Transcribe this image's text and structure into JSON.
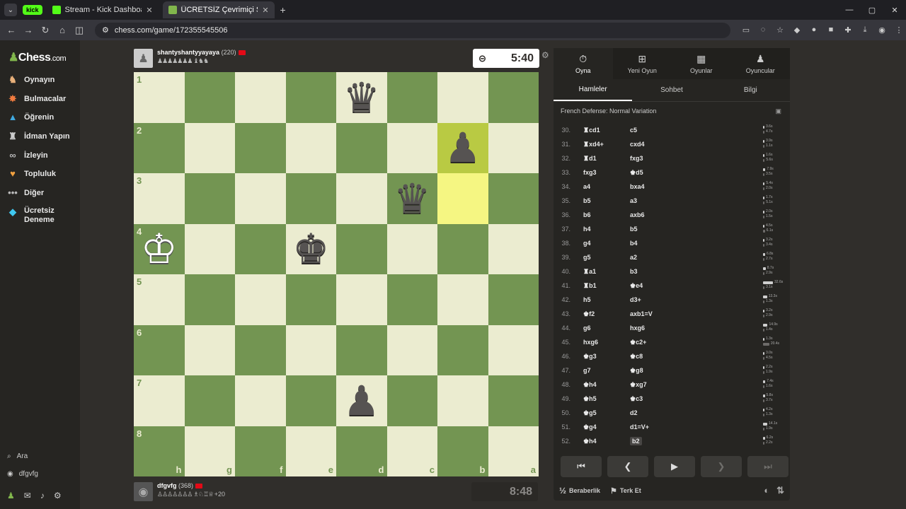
{
  "browser": {
    "tabs": [
      {
        "label": "Stream - Kick Dashboard",
        "favicon_color": "#53fc18"
      },
      {
        "label": "ÜCRETSİZ Çevrimiçi Satranç Oy...",
        "favicon_color": "#81b64c"
      }
    ],
    "tab_group": "kick",
    "url": "chess.com/game/172355545506"
  },
  "sidebar": {
    "logo_text": "Chess",
    "logo_suffix": ".com",
    "items": [
      {
        "label": "Oynayın",
        "icon": "play-board-icon"
      },
      {
        "label": "Bulmacalar",
        "icon": "puzzle-icon"
      },
      {
        "label": "Öğrenin",
        "icon": "learn-cap-icon"
      },
      {
        "label": "İdman Yapın",
        "icon": "train-icon"
      },
      {
        "label": "İzleyin",
        "icon": "binoculars-icon"
      },
      {
        "label": "Topluluk",
        "icon": "community-icon"
      },
      {
        "label": "Diğer",
        "icon": "more-dots-icon"
      },
      {
        "label": "Ücretsiz Deneme",
        "icon": "diamond-icon"
      }
    ],
    "search_label": "Ara",
    "user_label": "dfgvfg"
  },
  "top_player": {
    "name": "shantyshantyyayaya",
    "rating": "(220)",
    "captured": "♟♟♟♟♟♟♟ ♝♞♞"
  },
  "bottom_player": {
    "name": "dfgvfg",
    "rating": "(368)",
    "captured": "♙♙♙♙♙♙♙ ♗♘♖♕",
    "material": "+20"
  },
  "clocks": {
    "top": "5:40",
    "bottom": "8:48"
  },
  "board": {
    "ranks": [
      "1",
      "2",
      "3",
      "4",
      "5",
      "6",
      "7",
      "8"
    ],
    "files": [
      "h",
      "g",
      "f",
      "e",
      "d",
      "c",
      "b",
      "a"
    ],
    "pieces": [
      {
        "row": 0,
        "col": 4,
        "glyph": "♛",
        "color": "b"
      },
      {
        "row": 1,
        "col": 6,
        "glyph": "♟",
        "color": "b"
      },
      {
        "row": 2,
        "col": 5,
        "glyph": "♛",
        "color": "b"
      },
      {
        "row": 3,
        "col": 0,
        "glyph": "♔",
        "color": "w"
      },
      {
        "row": 3,
        "col": 3,
        "glyph": "♚",
        "color": "b"
      },
      {
        "row": 6,
        "col": 4,
        "glyph": "♟",
        "color": "b"
      }
    ],
    "highlights": [
      {
        "row": 1,
        "col": 6
      },
      {
        "row": 2,
        "col": 6
      }
    ]
  },
  "panel": {
    "tabs": [
      {
        "label": "Oyna",
        "icon": "stopwatch-icon"
      },
      {
        "label": "Yeni Oyun",
        "icon": "plus-square-icon"
      },
      {
        "label": "Oyunlar",
        "icon": "board-grid-icon"
      },
      {
        "label": "Oyuncular",
        "icon": "players-icon"
      }
    ],
    "subtabs": [
      "Hamleler",
      "Sohbet",
      "Bilgi"
    ],
    "opening": "French Defense: Normal Variation",
    "moves": [
      {
        "n": "30.",
        "w": "♜cd1",
        "b": "c5",
        "tw": "3.6s",
        "tb": "4.7s",
        "fw": 0.11,
        "fb": 0.14
      },
      {
        "n": "31.",
        "w": "♜xd4+",
        "b": "cxd4",
        "tw": "3.9s",
        "tb": "1.1s",
        "fw": 0.12,
        "fb": 0.03
      },
      {
        "n": "32.",
        "w": "♜d1",
        "b": "fxg3",
        "tw": "1.6s",
        "tb": "5.6s",
        "fw": 0.05,
        "fb": 0.17
      },
      {
        "n": "33.",
        "w": "fxg3",
        "b": "♚d5",
        "tw": "7.9s",
        "tb": "3.5s",
        "fw": 0.24,
        "fb": 0.11
      },
      {
        "n": "34.",
        "w": "a4",
        "b": "bxa4",
        "tw": "5.4s",
        "tb": "2.0s",
        "fw": 0.17,
        "fb": 0.06
      },
      {
        "n": "35.",
        "w": "b5",
        "b": "a3",
        "tw": "1.7s",
        "tb": "5.1s",
        "fw": 0.05,
        "fb": 0.16
      },
      {
        "n": "36.",
        "w": "b6",
        "b": "axb6",
        "tw": "2.0s",
        "tb": "1.5s",
        "fw": 0.06,
        "fb": 0.05
      },
      {
        "n": "37.",
        "w": "h4",
        "b": "b5",
        "tw": "4.5s",
        "tb": "6.1s",
        "fw": 0.14,
        "fb": 0.19
      },
      {
        "n": "38.",
        "w": "g4",
        "b": "b4",
        "tw": "3.2s",
        "tb": "3.4s",
        "fw": 0.1,
        "fb": 0.1
      },
      {
        "n": "39.",
        "w": "g5",
        "b": "a2",
        "tw": "6.8s",
        "tb": "2.7s",
        "fw": 0.21,
        "fb": 0.08
      },
      {
        "n": "40.",
        "w": "♜a1",
        "b": "b3",
        "tw": "8.7s",
        "tb": "2.9s",
        "fw": 0.27,
        "fb": 0.09
      },
      {
        "n": "41.",
        "w": "♜b1",
        "b": "♚e4",
        "tw": "32.6s",
        "tb": "3.1s",
        "fw": 1.0,
        "fb": 0.1
      },
      {
        "n": "42.",
        "w": "h5",
        "b": "d3+",
        "tw": "13.3s",
        "tb": "1.3s",
        "fw": 0.41,
        "fb": 0.04
      },
      {
        "n": "43.",
        "w": "♚f2",
        "b": "axb1=V",
        "tw": "3.2s",
        "tb": "2.9s",
        "fw": 0.1,
        "fb": 0.09
      },
      {
        "n": "44.",
        "w": "g6",
        "b": "hxg6",
        "tw": "14.9s",
        "tb": "1.4s",
        "fw": 0.46,
        "fb": 0.04
      },
      {
        "n": "45.",
        "w": "hxg6",
        "b": "♚c2+",
        "tw": "1.3s",
        "tb": "20.4s",
        "fw": 0.04,
        "fb": 0.63
      },
      {
        "n": "46.",
        "w": "♚g3",
        "b": "♚c8",
        "tw": "3.0s",
        "tb": "4.5s",
        "fw": 0.09,
        "fb": 0.14
      },
      {
        "n": "47.",
        "w": "g7",
        "b": "♚g8",
        "tw": "2.2s",
        "tb": "1.9s",
        "fw": 0.07,
        "fb": 0.06
      },
      {
        "n": "48.",
        "w": "♚h4",
        "b": "♚xg7",
        "tw": "7.4s",
        "tb": "1.6s",
        "fw": 0.23,
        "fb": 0.05
      },
      {
        "n": "49.",
        "w": "♚h5",
        "b": "♚c3",
        "tw": "5.8s",
        "tb": "3.7s",
        "fw": 0.18,
        "fb": 0.11
      },
      {
        "n": "50.",
        "w": "♚g5",
        "b": "d2",
        "tw": "4.2s",
        "tb": "1.3s",
        "fw": 0.13,
        "fb": 0.04
      },
      {
        "n": "51.",
        "w": "♚g4",
        "b": "d1=V+",
        "tw": "14.1s",
        "tb": "1.9s",
        "fw": 0.43,
        "fb": 0.06
      },
      {
        "n": "52.",
        "w": "♚h4",
        "b": "b2",
        "tw": "6.2s",
        "tb": "2.2s",
        "fw": 0.19,
        "fb": 0.07
      }
    ],
    "draw_label": "Beraberlik",
    "draw_icon_text": "½",
    "resign_label": "Terk Et"
  }
}
